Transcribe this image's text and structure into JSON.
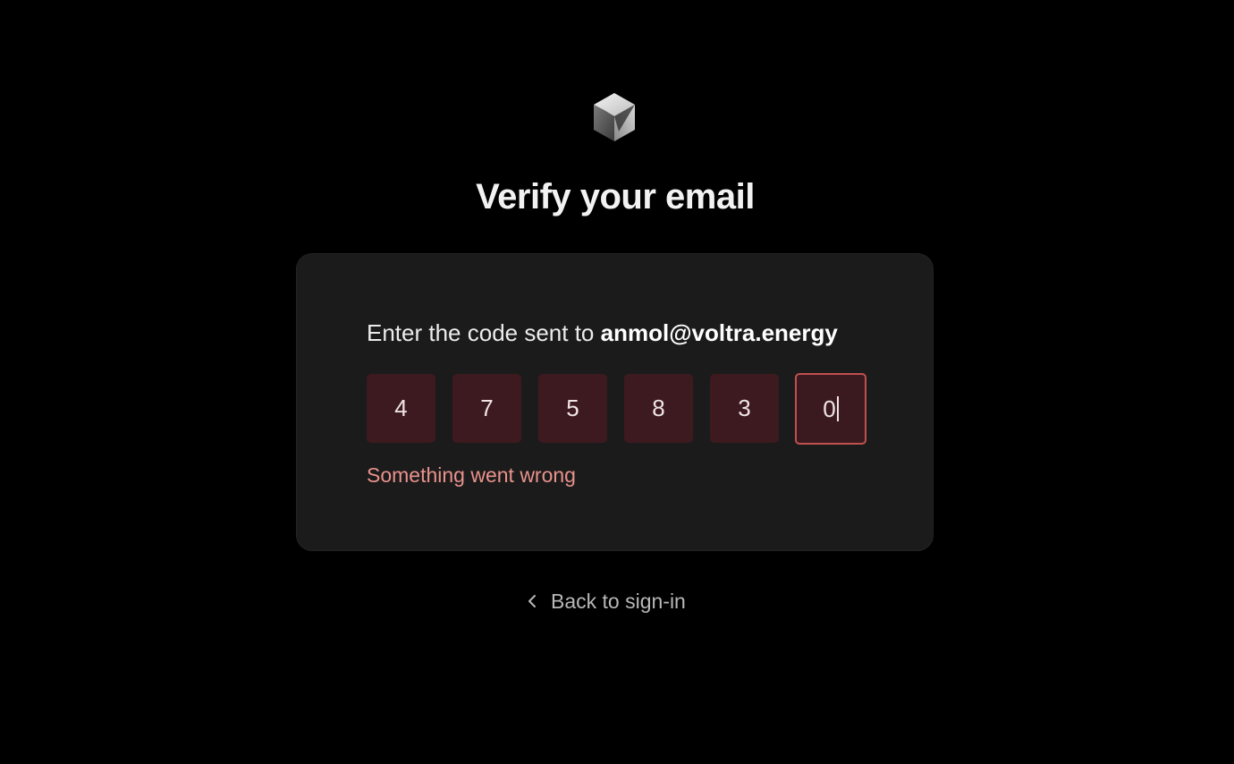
{
  "page": {
    "title": "Verify your email"
  },
  "brand": {
    "logo_icon": "cube-logo-icon"
  },
  "card": {
    "prompt_prefix": "Enter the code sent to ",
    "email": "anmol@voltra.energy",
    "code_digits": [
      "4",
      "7",
      "5",
      "8",
      "3",
      "0"
    ],
    "error_message": "Something went wrong"
  },
  "footer": {
    "back_label": "Back to sign-in",
    "back_icon": "chevron-left-icon"
  },
  "colors": {
    "background": "#000000",
    "card": "#1b1b1b",
    "digit_box": "#3d1a20",
    "active_border": "#c0504f",
    "error_text": "#e8928c"
  }
}
